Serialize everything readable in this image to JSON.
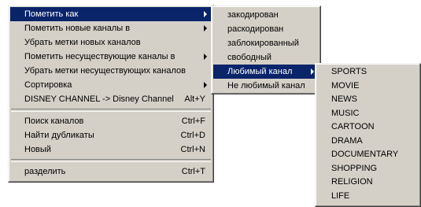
{
  "main_menu": {
    "items": [
      {
        "label": "Пометить как",
        "shortcut": "",
        "submenu": true,
        "selected": true
      },
      {
        "label": "Пометить новые каналы в",
        "shortcut": "",
        "submenu": true,
        "selected": false
      },
      {
        "label": "Убрать метки новых каналов",
        "shortcut": "",
        "submenu": false,
        "selected": false
      },
      {
        "label": "Пометить несуществующие каналы в",
        "shortcut": "",
        "submenu": true,
        "selected": false
      },
      {
        "label": "Убрать метки несуществующих каналов",
        "shortcut": "",
        "submenu": false,
        "selected": false
      },
      {
        "label": "Сортировка",
        "shortcut": "",
        "submenu": true,
        "selected": false
      },
      {
        "label": "DISNEY CHANNEL -> Disney Channel",
        "shortcut": "Alt+Y",
        "submenu": false,
        "selected": false
      },
      {
        "label": "Поиск каналов",
        "shortcut": "Ctrl+F",
        "submenu": false,
        "selected": false
      },
      {
        "label": "Найти дубликаты",
        "shortcut": "Ctrl+D",
        "submenu": false,
        "selected": false
      },
      {
        "label": "Новый",
        "shortcut": "Ctrl+N",
        "submenu": false,
        "selected": false
      },
      {
        "label": "разделить",
        "shortcut": "Ctrl+T",
        "submenu": false,
        "selected": false
      }
    ]
  },
  "mark_as_menu": {
    "items": [
      {
        "label": "закодирован",
        "submenu": false,
        "selected": false
      },
      {
        "label": "раскодирован",
        "submenu": false,
        "selected": false
      },
      {
        "label": "заблокированный",
        "submenu": false,
        "selected": false
      },
      {
        "label": "свободный",
        "submenu": false,
        "selected": false
      },
      {
        "label": "Любимый канал",
        "submenu": true,
        "selected": true
      },
      {
        "label": "Не любимый канал",
        "submenu": false,
        "selected": false
      }
    ]
  },
  "favorite_menu": {
    "items": [
      {
        "label": "SPORTS"
      },
      {
        "label": "MOVIE"
      },
      {
        "label": "NEWS"
      },
      {
        "label": "MUSIC"
      },
      {
        "label": "CARTOON"
      },
      {
        "label": "DRAMA"
      },
      {
        "label": "DOCUMENTARY"
      },
      {
        "label": "SHOPPING"
      },
      {
        "label": "RELIGION"
      },
      {
        "label": "LIFE"
      }
    ]
  },
  "colors": {
    "menu_background": "#d4d0c8",
    "selection_background": "#0a246a",
    "selection_text": "#ffffff"
  }
}
